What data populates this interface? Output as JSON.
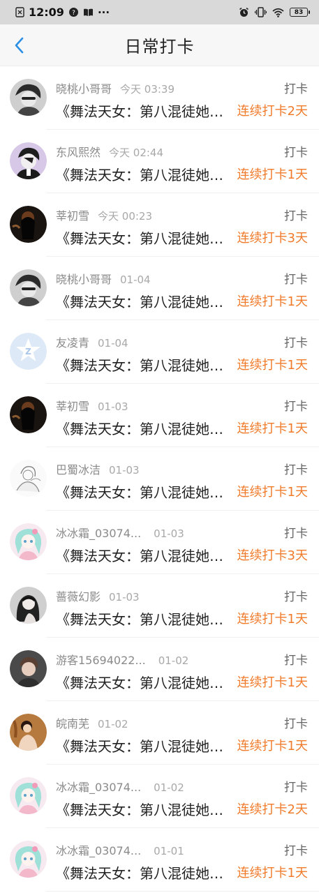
{
  "status_bar": {
    "time": "12:09",
    "left_icons": [
      "sim-icon",
      "help-circle-icon",
      "book-icon"
    ],
    "more": "···",
    "right_icons": [
      "alarm-icon",
      "vibrate-icon",
      "wifi-icon"
    ],
    "battery": "83"
  },
  "header": {
    "title": "日常打卡",
    "back_icon": "chevron-left-icon"
  },
  "colors": {
    "accent_orange": "#f07b2b",
    "back_blue": "#2b8fe6",
    "status_bar_bg": "#d9d9d9"
  },
  "entries": [
    {
      "name": "晓桃小哥哥",
      "time": "今天 03:39",
      "action": "打卡",
      "novel": "《舞法天女：第八混徒她…",
      "streak": "连续打卡2天",
      "avatar": "avatar-1"
    },
    {
      "name": "东风熙然",
      "time": "今天 02:44",
      "action": "打卡",
      "novel": "《舞法天女：第八混徒她…",
      "streak": "连续打卡1天",
      "avatar": "avatar-2"
    },
    {
      "name": "莘初雪",
      "time": "今天 00:23",
      "action": "打卡",
      "novel": "《舞法天女：第八混徒她…",
      "streak": "连续打卡3天",
      "avatar": "avatar-3"
    },
    {
      "name": "晓桃小哥哥",
      "time": "01-04",
      "action": "打卡",
      "novel": "《舞法天女：第八混徒她…",
      "streak": "连续打卡1天",
      "avatar": "avatar-1"
    },
    {
      "name": "友凌青",
      "time": "01-04",
      "action": "打卡",
      "novel": "《舞法天女：第八混徒她…",
      "streak": "连续打卡1天",
      "avatar": "avatar-default"
    },
    {
      "name": "莘初雪",
      "time": "01-03",
      "action": "打卡",
      "novel": "《舞法天女：第八混徒她…",
      "streak": "连续打卡1天",
      "avatar": "avatar-3"
    },
    {
      "name": "巴蜀冰洁",
      "time": "01-03",
      "action": "打卡",
      "novel": "《舞法天女：第八混徒她…",
      "streak": "连续打卡1天",
      "avatar": "avatar-sketch"
    },
    {
      "name": "冰冰霜_03074...",
      "time": "01-03",
      "action": "打卡",
      "novel": "《舞法天女：第八混徒她…",
      "streak": "连续打卡3天",
      "avatar": "avatar-anime"
    },
    {
      "name": "蔷薇幻影",
      "time": "01-03",
      "action": "打卡",
      "novel": "《舞法天女：第八混徒她…",
      "streak": "连续打卡1天",
      "avatar": "avatar-dark-hair"
    },
    {
      "name": "游客15694022...",
      "time": "01-02",
      "action": "打卡",
      "novel": "《舞法天女：第八混徒她…",
      "streak": "连续打卡1天",
      "avatar": "avatar-portrait"
    },
    {
      "name": "皖南芜",
      "time": "01-02",
      "action": "打卡",
      "novel": "《舞法天女：第八混徒她…",
      "streak": "连续打卡1天",
      "avatar": "avatar-warm"
    },
    {
      "name": "冰冰霜_03074...",
      "time": "01-02",
      "action": "打卡",
      "novel": "《舞法天女：第八混徒她…",
      "streak": "连续打卡2天",
      "avatar": "avatar-anime"
    },
    {
      "name": "冰冰霜_03074...",
      "time": "01-01",
      "action": "打卡",
      "novel": "《舞法天女：第八混徒她…",
      "streak": "连续打卡1天",
      "avatar": "avatar-anime"
    }
  ]
}
